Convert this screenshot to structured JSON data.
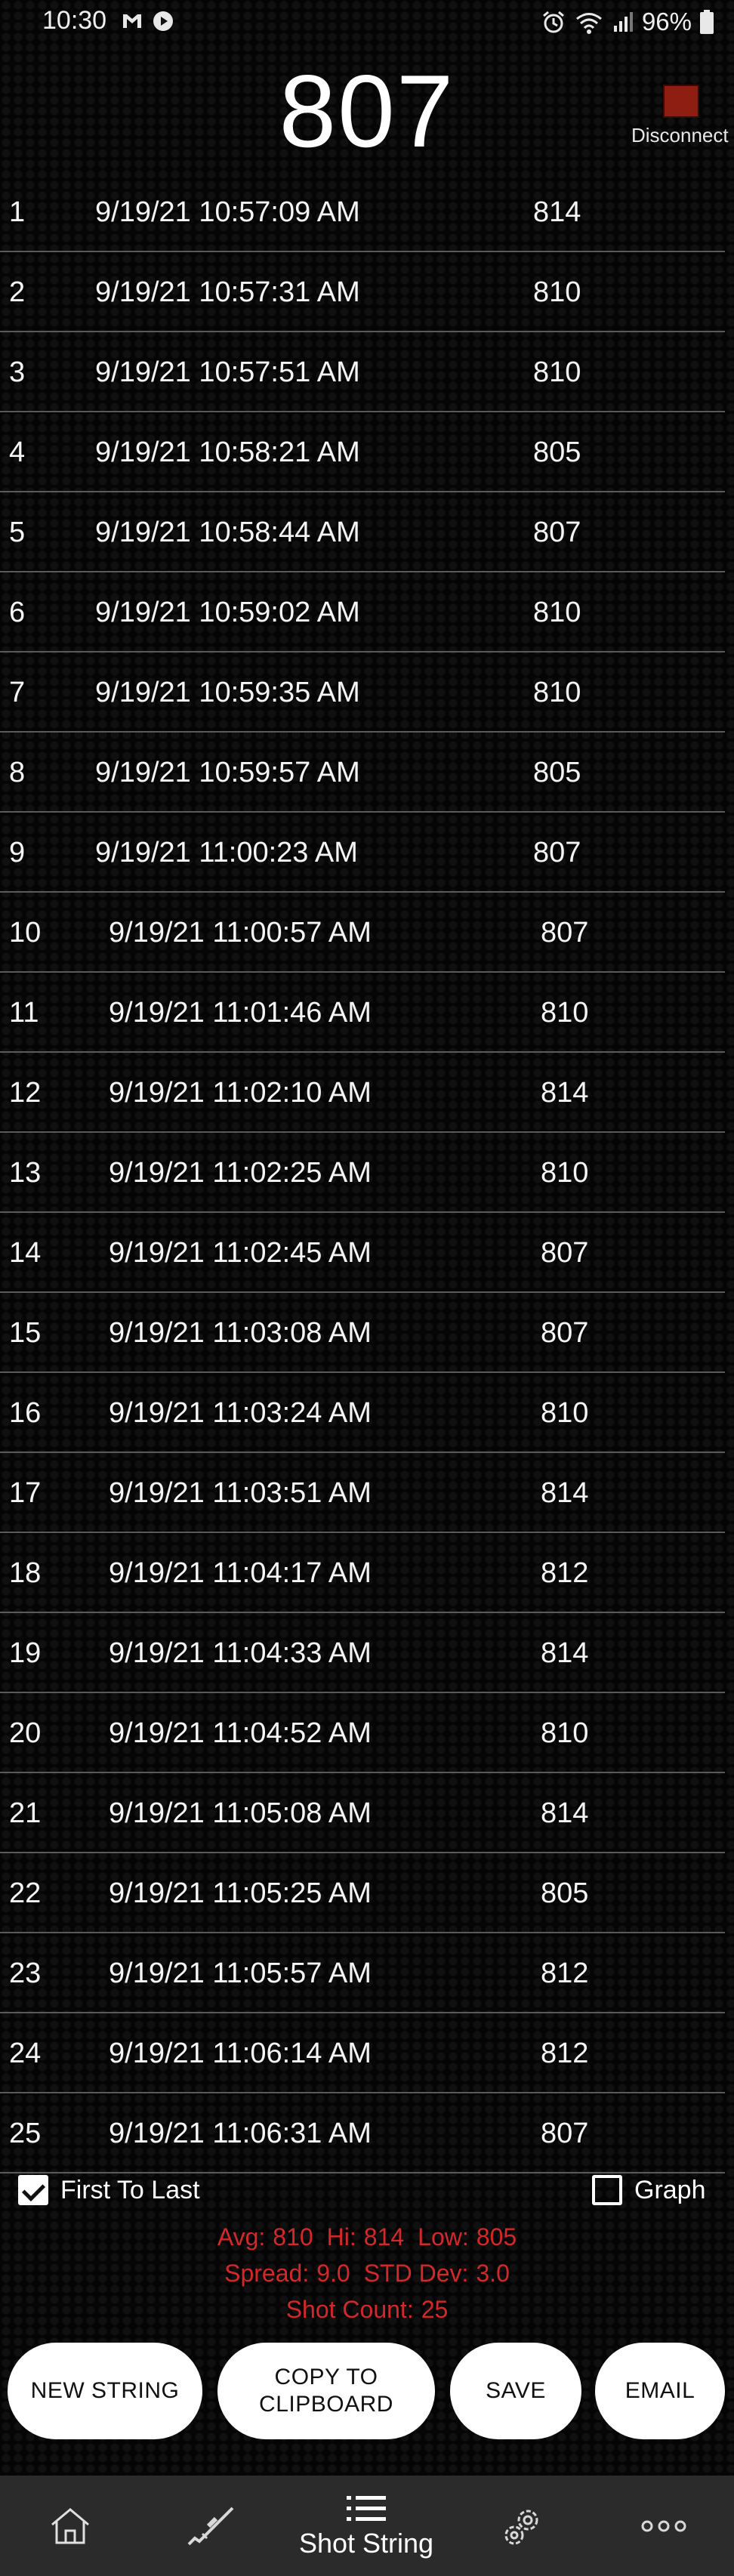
{
  "status_bar": {
    "time": "10:30",
    "battery": "96%"
  },
  "header": {
    "current_velocity": "807",
    "disconnect_label": "Disconnect"
  },
  "shots": [
    {
      "index": "1",
      "timestamp": "9/19/21 10:57:09 AM",
      "velocity": "814"
    },
    {
      "index": "2",
      "timestamp": "9/19/21 10:57:31 AM",
      "velocity": "810"
    },
    {
      "index": "3",
      "timestamp": "9/19/21 10:57:51 AM",
      "velocity": "810"
    },
    {
      "index": "4",
      "timestamp": "9/19/21 10:58:21 AM",
      "velocity": "805"
    },
    {
      "index": "5",
      "timestamp": "9/19/21 10:58:44 AM",
      "velocity": "807"
    },
    {
      "index": "6",
      "timestamp": "9/19/21 10:59:02 AM",
      "velocity": "810"
    },
    {
      "index": "7",
      "timestamp": "9/19/21 10:59:35 AM",
      "velocity": "810"
    },
    {
      "index": "8",
      "timestamp": "9/19/21 10:59:57 AM",
      "velocity": "805"
    },
    {
      "index": "9",
      "timestamp": "9/19/21 11:00:23 AM",
      "velocity": "807"
    },
    {
      "index": "10",
      "timestamp": "9/19/21 11:00:57 AM",
      "velocity": "807"
    },
    {
      "index": "11",
      "timestamp": "9/19/21 11:01:46 AM",
      "velocity": "810"
    },
    {
      "index": "12",
      "timestamp": "9/19/21 11:02:10 AM",
      "velocity": "814"
    },
    {
      "index": "13",
      "timestamp": "9/19/21 11:02:25 AM",
      "velocity": "810"
    },
    {
      "index": "14",
      "timestamp": "9/19/21 11:02:45 AM",
      "velocity": "807"
    },
    {
      "index": "15",
      "timestamp": "9/19/21 11:03:08 AM",
      "velocity": "807"
    },
    {
      "index": "16",
      "timestamp": "9/19/21 11:03:24 AM",
      "velocity": "810"
    },
    {
      "index": "17",
      "timestamp": "9/19/21 11:03:51 AM",
      "velocity": "814"
    },
    {
      "index": "18",
      "timestamp": "9/19/21 11:04:17 AM",
      "velocity": "812"
    },
    {
      "index": "19",
      "timestamp": "9/19/21 11:04:33 AM",
      "velocity": "814"
    },
    {
      "index": "20",
      "timestamp": "9/19/21 11:04:52 AM",
      "velocity": "810"
    },
    {
      "index": "21",
      "timestamp": "9/19/21 11:05:08 AM",
      "velocity": "814"
    },
    {
      "index": "22",
      "timestamp": "9/19/21 11:05:25 AM",
      "velocity": "805"
    },
    {
      "index": "23",
      "timestamp": "9/19/21 11:05:57 AM",
      "velocity": "812"
    },
    {
      "index": "24",
      "timestamp": "9/19/21 11:06:14 AM",
      "velocity": "812"
    },
    {
      "index": "25",
      "timestamp": "9/19/21 11:06:31 AM",
      "velocity": "807"
    }
  ],
  "controls": {
    "first_to_last_label": "First To Last",
    "first_to_last_checked": true,
    "graph_label": "Graph",
    "graph_checked": false
  },
  "stats": {
    "avg_label": "Avg:",
    "avg": "810",
    "hi_label": "Hi:",
    "hi": "814",
    "low_label": "Low:",
    "low": "805",
    "spread_label": "Spread:",
    "spread": "9.0",
    "std_label": "STD Dev:",
    "std": "3.0",
    "count_label": "Shot Count:",
    "count": "25",
    "color": "#d3282a"
  },
  "buttons": {
    "new_string": "NEW STRING",
    "copy_line1": "COPY TO",
    "copy_line2": "CLIPBOARD",
    "save": "SAVE",
    "email": "EMAIL"
  },
  "nav": {
    "home_icon": "home-icon",
    "rifle_icon": "rifle-icon",
    "shot_string_icon": "list-icon",
    "shot_string_label": "Shot String",
    "settings_icon": "gear-icon",
    "more_icon": "more-icon"
  }
}
